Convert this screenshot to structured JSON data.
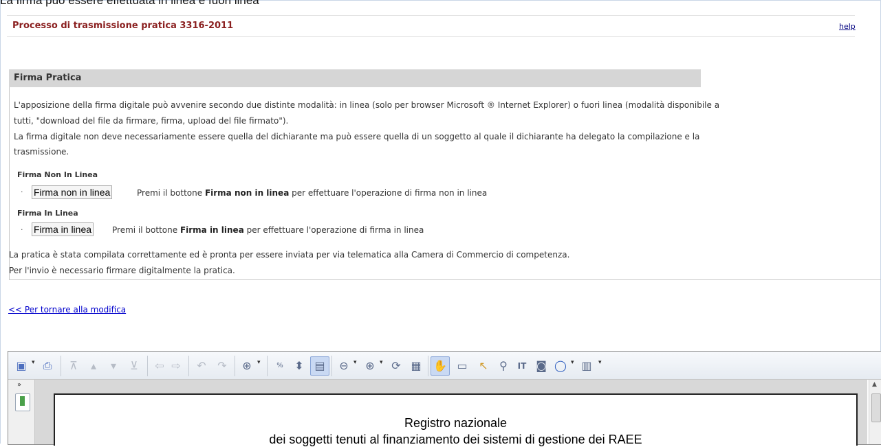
{
  "caption": "La firma può essere effettuata in linea e fuori linea",
  "header": {
    "title": "Processo di trasmissione pratica 3316-2011",
    "help_label": "help"
  },
  "section": {
    "title": "Firma Pratica",
    "intro_line1": "L'apposizione della firma digitale può avvenire secondo due distinte modalità: in linea (solo per browser Microsoft ® Internet Explorer) o fuori linea (modalità disponibile a",
    "intro_line2": "tutti, \"download del file da firmare, firma, upload del file firmato\").",
    "intro_line3": "La firma digitale non deve necessariamente essere quella del dichiarante ma può essere quella di un soggetto al quale il dichiarante ha delegato la compilazione e la",
    "intro_line4": "trasmissione.",
    "offline": {
      "heading": "Firma Non In Linea",
      "button_label": "Firma non in linea",
      "desc_prefix": "Premi il bottone",
      "desc_bold": "Firma non in linea",
      "desc_suffix": "per effettuare l'operazione di firma non in linea"
    },
    "online": {
      "heading": "Firma In Linea",
      "button_label": "Firma in linea",
      "desc_prefix": "Premi il bottone",
      "desc_bold": "Firma in linea",
      "desc_suffix": "per effettuare l'operazione di firma in linea"
    },
    "footer_line1": "La pratica è stata compilata correttamente ed è pronta per essere inviata per via telematica alla Camera di Commercio di competenza.",
    "footer_line2": "Per l'invio è necessario firmare digitalmente la pratica."
  },
  "back_link": "<< Per tornare alla modifica",
  "viewer": {
    "toolbar_icons": [
      "save-icon",
      "print-icon",
      "first-page-icon",
      "previous-page-icon",
      "next-page-icon",
      "last-page-icon",
      "back-view-icon",
      "forward-view-icon",
      "undo-icon",
      "redo-icon",
      "zoom-in-icon",
      "actual-size-icon",
      "fit-page-icon",
      "fit-width-icon",
      "zoom-out-circle-icon",
      "zoom-in-circle-icon",
      "rotate-icon",
      "page-layout-icon",
      "hand-tool-icon",
      "loupe-icon",
      "select-arrow-icon",
      "find-icon",
      "text-select-icon",
      "snapshot-icon",
      "shape-icon",
      "text-field-icon"
    ],
    "document_line1": "Registro nazionale",
    "document_line2": "dei soggetti tenuti al finanziamento dei sistemi di gestione dei RAEE"
  },
  "colors": {
    "title": "#8a1f1f",
    "link": "#0000cc",
    "panel_header": "#d6d6d6",
    "toolbar_active": "#c9d9f3"
  }
}
